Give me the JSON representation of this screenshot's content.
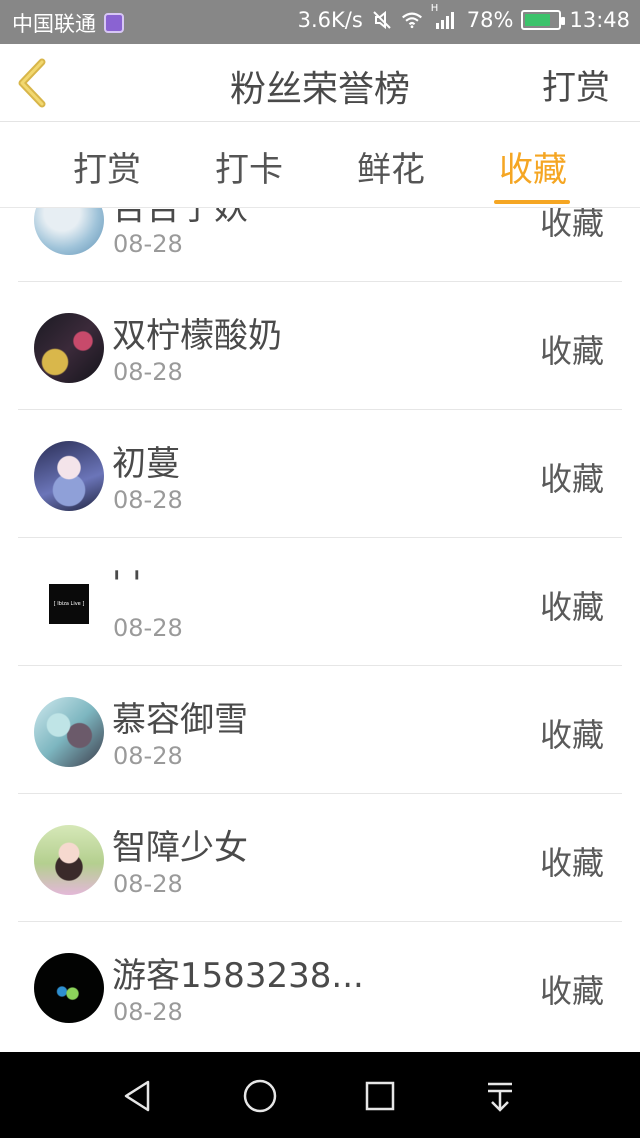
{
  "status_bar": {
    "carrier": "中国联通",
    "speed": "3.6K/s",
    "signal_label": "H",
    "battery": "78%",
    "battery_level": 0.78,
    "time": "13:48"
  },
  "header": {
    "title": "粉丝荣誉榜",
    "action": "打赏"
  },
  "tabs": [
    {
      "label": "打赏"
    },
    {
      "label": "打卡"
    },
    {
      "label": "鲜花"
    },
    {
      "label": "收藏",
      "active": true
    }
  ],
  "list": [
    {
      "name": "吉吉子妖",
      "date": "08-28",
      "action": "收藏"
    },
    {
      "name": "双柠檬酸奶",
      "date": "08-28",
      "action": "收藏"
    },
    {
      "name": "初蔓",
      "date": "08-28",
      "action": "收藏"
    },
    {
      "name": "' '",
      "date": "08-28",
      "action": "收藏",
      "avatar_text": "[ Ibiza Live ]"
    },
    {
      "name": "慕容御雪",
      "date": "08-28",
      "action": "收藏"
    },
    {
      "name": "智障少女",
      "date": "08-28",
      "action": "收藏"
    },
    {
      "name": "游客1583238...",
      "date": "08-28",
      "action": "收藏"
    }
  ],
  "colors": {
    "accent": "#f5a623",
    "status_bar": "#878787",
    "text": "#4a4a4a",
    "muted": "#9a9a9a"
  }
}
